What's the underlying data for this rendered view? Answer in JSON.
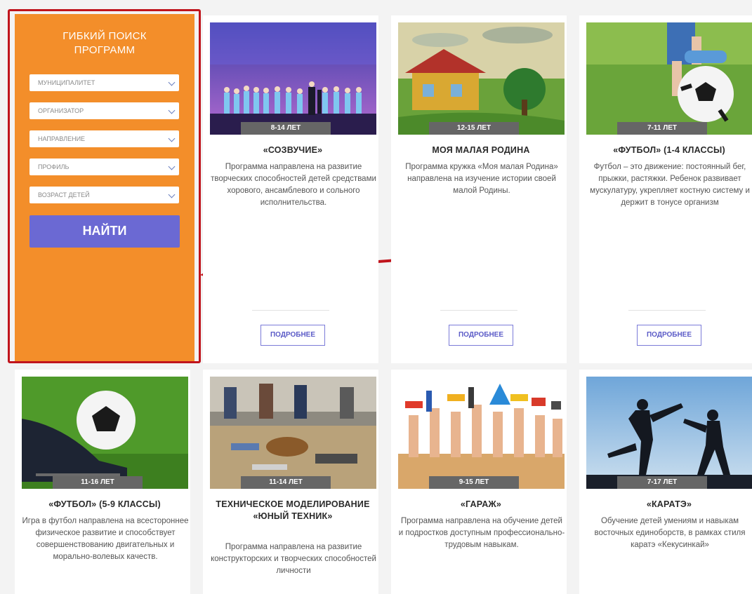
{
  "sidebar": {
    "title_line1": "ГИБКИЙ ПОИСК",
    "title_line2": "ПРОГРАММ",
    "filters": [
      {
        "label": "МУНИЦИПАЛИТЕТ"
      },
      {
        "label": "ОРГАНИЗАТОР"
      },
      {
        "label": "НАПРАВЛЕНИЕ"
      },
      {
        "label": "ПРОФИЛЬ"
      },
      {
        "label": "ВОЗРАСТ ДЕТЕЙ"
      }
    ],
    "find_label": "НАЙТИ"
  },
  "colors": {
    "sidebar_bg": "#f38e2a",
    "button_bg": "#6b69d3",
    "highlight_border": "#c0141c",
    "arrow": "#c0141c"
  },
  "more_label": "ПОДРОБНЕЕ",
  "cards": [
    {
      "age": "8-14 ЛЕТ",
      "title": "«СОЗВУЧИЕ»",
      "description": "Программа направлена на развитие творческих способностей детей средствами хорового, ансамблевого и сольного исполнительства.",
      "image": "choir-stage-photo"
    },
    {
      "age": "12-15 ЛЕТ",
      "title": "МОЯ МАЛАЯ РОДИНА",
      "description": "Программа кружка «Моя малая Родина» направлена на изучение истории своей малой Родины.",
      "image": "village-house-painting"
    },
    {
      "age": "7-11 ЛЕТ",
      "title": "«ФУТБОЛ» (1-4 КЛАССЫ)",
      "description": "Футбол – это движение: постоянный бег, прыжки, растяжки. Ребенок развивает мускулатуру, укрепляет костную систему и держит в тонусе организм",
      "image": "child-with-soccer-ball-photo"
    },
    {
      "age": "11-16 ЛЕТ",
      "title": "«ФУТБОЛ» (5-9 КЛАССЫ)",
      "description": "Игра в футбол направлена на всестороннее физическое развитие и способствует совершенствованию двигательных и морально-волевых качеств.",
      "image": "boot-and-soccer-ball-photo"
    },
    {
      "age": "11-14 ЛЕТ",
      "title": "ТЕХНИЧЕСКОЕ МОДЕЛИРОВАНИЕ «ЮНЫЙ ТЕХНИК»",
      "description": "Программа направлена на развитие конструкторских и творческих способностей личности",
      "image": "model-workshop-photo"
    },
    {
      "age": "9-15 ЛЕТ",
      "title": "«ГАРАЖ»",
      "description": "Программа направлена на обучение детей и подростков доступным профессионально-трудовым навыкам.",
      "image": "hands-with-tools-photo"
    },
    {
      "age": "7-17 ЛЕТ",
      "title": "«КАРАТЭ»",
      "description": "Обучение детей умениям и навыкам восточных единоборств, в рамках стиля каратэ «Кекусинкай»",
      "image": "karate-silhouettes-photo"
    }
  ]
}
